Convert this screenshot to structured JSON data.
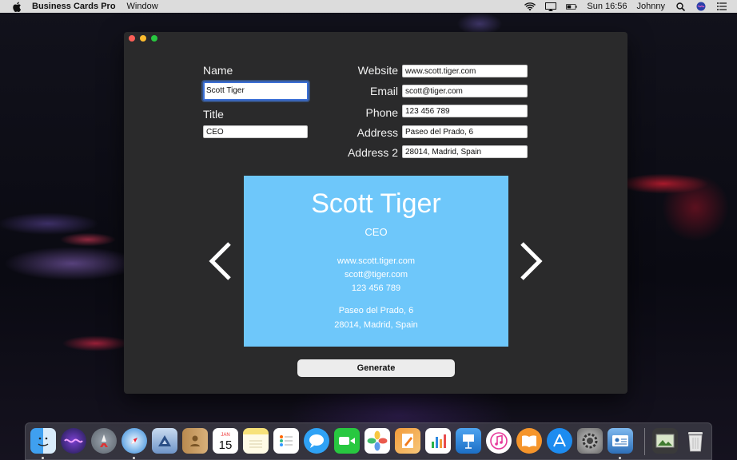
{
  "menubar": {
    "app_name": "Business Cards Pro",
    "menus": [
      "Window"
    ],
    "clock": "Sun 16:56",
    "user": "Johnny"
  },
  "form": {
    "name_label": "Name",
    "name_value": "Scott Tiger",
    "title_label": "Title",
    "title_value": "CEO",
    "website_label": "Website",
    "website_value": "www.scott.tiger.com",
    "email_label": "Email",
    "email_value": "scott@tiger.com",
    "phone_label": "Phone",
    "phone_value": "123 456 789",
    "address_label": "Address",
    "address_value": "Paseo del Prado, 6",
    "address2_label": "Address 2",
    "address2_value": "28014, Madrid, Spain"
  },
  "card": {
    "name": "Scott Tiger",
    "title": "CEO",
    "website": "www.scott.tiger.com",
    "email": "scott@tiger.com",
    "phone": "123 456 789",
    "address": "Paseo del Prado, 6",
    "address2": "28014, Madrid, Spain",
    "background_color": "#6ec7fa"
  },
  "actions": {
    "generate_label": "Generate"
  },
  "dock": {
    "calendar_month": "JAN",
    "calendar_day": "15",
    "apps": [
      "finder-icon",
      "siri-icon",
      "launchpad-icon",
      "safari-icon",
      "mail-icon",
      "contacts-icon",
      "calendar-icon",
      "notes-icon",
      "reminders-icon",
      "messages-icon",
      "facetime-icon",
      "photos-icon",
      "pages-icon",
      "numbers-icon",
      "keynote-icon",
      "itunes-icon",
      "ibooks-icon",
      "app-store-icon",
      "system-preferences-icon",
      "business-cards-icon",
      "image-viewer-icon",
      "trash-icon"
    ]
  },
  "colors": {
    "window_bg": "#2a2a2b",
    "card_bg": "#6ec7fa",
    "focus_ring": "#3b6fd6"
  }
}
